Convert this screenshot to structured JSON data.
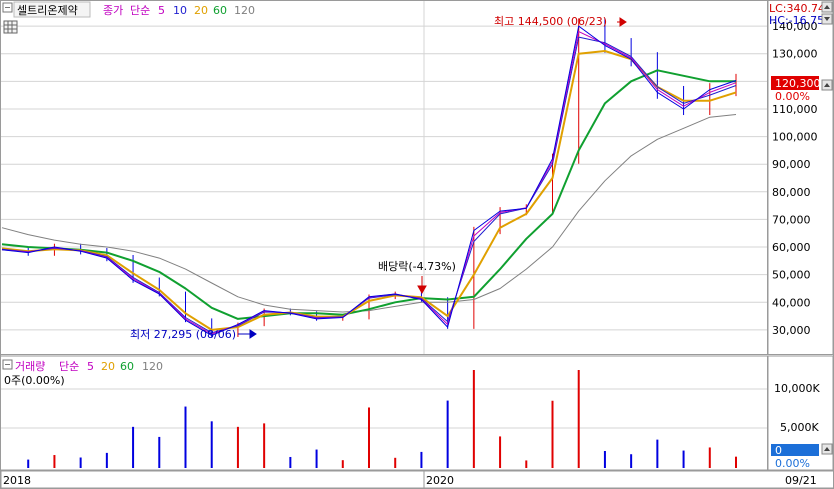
{
  "header": {
    "stock_name": "셀트리온제약",
    "price_label": "종가",
    "ma_label": "단순",
    "ma_periods": [
      "5",
      "10",
      "20",
      "60",
      "120"
    ],
    "lc_label": "LC:340.74",
    "hc_label": "HC:-16.75"
  },
  "volume_header": {
    "title": "거래량",
    "ma_label": "단순",
    "ma_periods": [
      "5",
      "20",
      "60",
      "120"
    ],
    "current": "0주(0.00%)"
  },
  "annotations": {
    "high": "최고 144,500 (06/23)",
    "low": "최저 27,295 (08/06)",
    "dividend": "배당락(-4.73%)"
  },
  "price_axis": {
    "ticks": [
      "30,000",
      "40,000",
      "50,000",
      "60,000",
      "70,000",
      "80,000",
      "90,000",
      "100,000",
      "110,000",
      "120,000",
      "130,000",
      "140,000"
    ],
    "last_price": "120,300",
    "last_change": "0.00%"
  },
  "volume_axis": {
    "ticks": [
      "5,000K",
      "10,000K"
    ],
    "last_volume": "0",
    "last_change": "0.00%"
  },
  "date_axis": [
    "2018",
    "2020",
    "09/21"
  ],
  "colors": {
    "ma5": "#c000c0",
    "ma10": "#2020d0",
    "ma20": "#e0a000",
    "ma60": "#10a030",
    "ma120": "#808080",
    "up": "#e00000",
    "down": "#0000e0",
    "grid": "#d4d4d4",
    "annotation_high": "#d00000",
    "annotation_low": "#0000c0",
    "last_price_bg": "#e00000",
    "last_volume_bg": "#1c6fd8"
  },
  "chart_data": {
    "type": "line",
    "title": "셀트리온제약",
    "ylim": [
      22000,
      148000
    ],
    "series": [
      {
        "name": "종가",
        "style": "candlestick",
        "x": [
          "2018-01",
          "2018-03",
          "2018-05",
          "2018-07",
          "2018-09",
          "2018-11",
          "2019-01",
          "2019-03",
          "2019-05",
          "2019-07",
          "2019-08",
          "2019-10",
          "2019-12",
          "2020-01",
          "2020-03",
          "2020-05",
          "2020-06",
          "2020-07",
          "2020-08",
          "2020-09",
          "2020-11",
          "2021-01",
          "2021-03",
          "2021-04",
          "2021-05",
          "2021-06",
          "2021-07",
          "2021-08",
          "2021-09"
        ],
        "values": [
          59000,
          58000,
          60000,
          58500,
          56000,
          48000,
          43000,
          33500,
          28000,
          32000,
          37000,
          36000,
          34000,
          34500,
          42000,
          43000,
          41000,
          31000,
          66000,
          73000,
          74000,
          92000,
          140000,
          133000,
          128000,
          116000,
          110000,
          117000,
          120300
        ]
      },
      {
        "name": "5",
        "values": [
          59000,
          58200,
          59800,
          58600,
          56200,
          48500,
          43200,
          34000,
          28500,
          31800,
          36800,
          36100,
          34200,
          34600,
          41800,
          43000,
          41200,
          32000,
          64000,
          72500,
          74200,
          91000,
          138000,
          133500,
          128500,
          117000,
          111000,
          116000,
          119500
        ]
      },
      {
        "name": "10",
        "values": [
          59200,
          58300,
          59600,
          58700,
          56500,
          49000,
          43500,
          34500,
          29000,
          31500,
          36500,
          36200,
          34400,
          34700,
          41500,
          42800,
          41400,
          33000,
          62000,
          72000,
          74100,
          90000,
          136000,
          134000,
          129000,
          118000,
          112000,
          115000,
          118500
        ]
      },
      {
        "name": "20",
        "values": [
          59500,
          58500,
          59200,
          58800,
          57000,
          50500,
          44500,
          36000,
          30000,
          31000,
          35500,
          36300,
          34800,
          34800,
          40500,
          42500,
          41800,
          35000,
          50000,
          67000,
          72000,
          85000,
          130000,
          131000,
          128000,
          118000,
          113000,
          113000,
          116000
        ]
      },
      {
        "name": "60",
        "values": [
          61000,
          60000,
          59500,
          59000,
          58000,
          55000,
          51000,
          45000,
          38000,
          34000,
          35000,
          36000,
          36000,
          35500,
          37500,
          40000,
          41500,
          41000,
          42000,
          52000,
          63000,
          72000,
          95000,
          112000,
          120000,
          124000,
          122000,
          120000,
          120000
        ]
      },
      {
        "name": "120",
        "values": [
          67000,
          64500,
          62500,
          61000,
          60000,
          58500,
          56000,
          52000,
          47000,
          42000,
          39000,
          37500,
          37000,
          36500,
          37000,
          38500,
          40000,
          40000,
          41000,
          45000,
          52000,
          60000,
          73000,
          84000,
          93000,
          99000,
          103000,
          107000,
          108000
        ]
      }
    ]
  }
}
